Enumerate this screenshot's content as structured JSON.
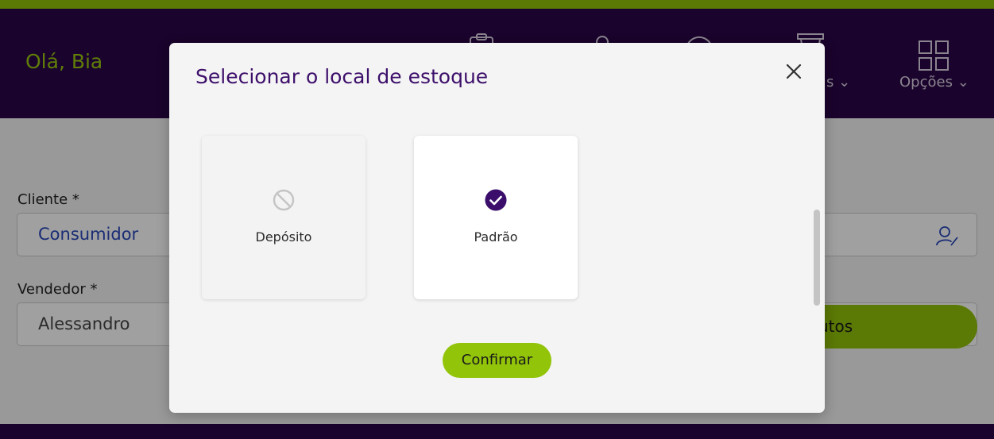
{
  "header": {
    "greeting": "Olá, Bia",
    "nav_partial_label": "s",
    "options_label": "Opções"
  },
  "form": {
    "client_label": "Cliente *",
    "client_value": "Consumidor",
    "seller_label": "Vendedor *",
    "seller_value": "Alessandro",
    "products_button_partial": "utos"
  },
  "modal": {
    "title": "Selecionar o local de estoque",
    "options": [
      {
        "label": "Depósito",
        "state": "disabled",
        "icon": "block-icon"
      },
      {
        "label": "Padrão",
        "state": "selected",
        "icon": "check-circle-icon"
      }
    ],
    "confirm_label": "Confirmar"
  },
  "colors": {
    "brand_purple": "#2a0646",
    "brand_green": "#8fbe08",
    "title_purple": "#3d0f6b",
    "client_blue": "#2845b8"
  }
}
